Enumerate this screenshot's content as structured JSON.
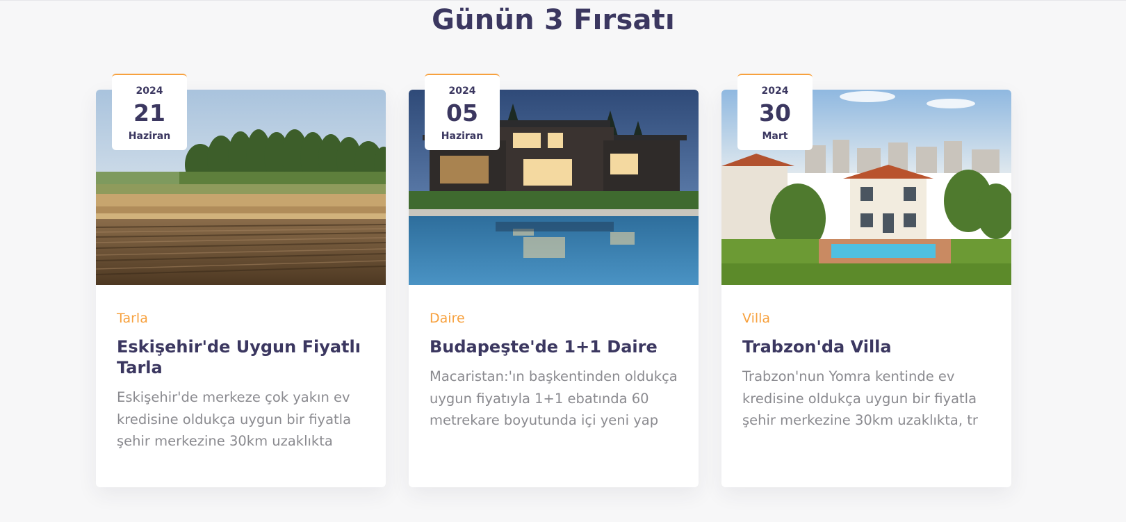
{
  "section": {
    "title": "Günün 3 Fırsatı"
  },
  "cards": [
    {
      "year": "2024",
      "day": "21",
      "month": "Haziran",
      "category": "Tarla",
      "title": "Eskişehir'de Uygun Fiyatlı Tarla",
      "description": "Eskişehir'de merkeze çok yakın ev kredisine oldukça uygun bir fiyatla şehir merkezine 30km uzaklıkta"
    },
    {
      "year": "2024",
      "day": "05",
      "month": "Haziran",
      "category": "Daire",
      "title": "Budapeşte'de 1+1 Daire",
      "description": "Macaristan:'ın başkentinden oldukça uygun fiyatıyla 1+1 ebatında 60 metrekare boyutunda içi yeni yap"
    },
    {
      "year": "2024",
      "day": "30",
      "month": "Mart",
      "category": "Villa",
      "title": "Trabzon'da Villa",
      "description": "Trabzon'nun Yomra kentinde ev kredisine oldukça uygun bir fiyatla şehir merkezine 30km uzaklıkta, tr"
    }
  ],
  "colors": {
    "accent": "#f7a13e",
    "heading": "#3b3760",
    "body_text": "#8a8a8f",
    "page_background": "#f7f7f8"
  }
}
